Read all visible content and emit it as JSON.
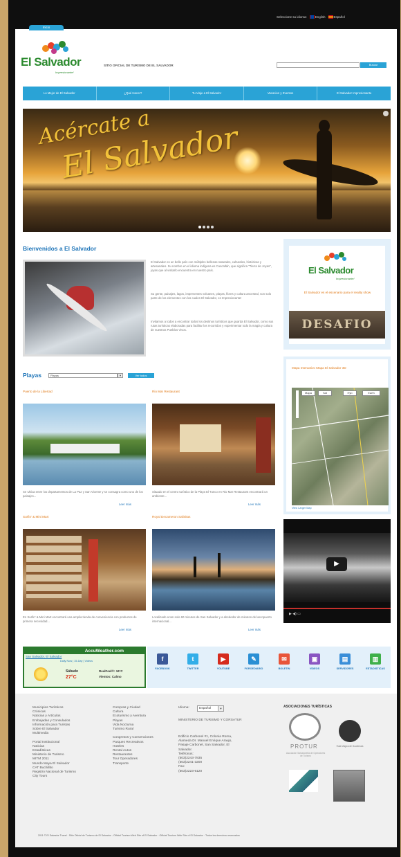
{
  "topbar": {
    "label": "Seleccione su idioma:",
    "english": "English",
    "espanol": "Español"
  },
  "tab": {
    "label": "Inicio"
  },
  "header": {
    "logo": "El Salvador",
    "logo_sub": "Impresionante!",
    "tagline": "SITIO OFICIAL DE TURISMO DE EL SALVADOR",
    "search_button": "Buscar"
  },
  "nav": [
    "Lo Mejor de El Salvador",
    "¿Qué Hacer?",
    "Tu Viaje a El Salvador",
    "Vacacion y Eventos",
    "El Salvador Impresionante"
  ],
  "hero": {
    "line1": "Acércate a",
    "line2": "El Salvador"
  },
  "welcome": {
    "title": "Bienvenidos a El Salvador",
    "p1": "El Salvador es un bello país con múltiples bellezas naturales, culturales, históricas y artesanales. Su nombre en el idioma indígena es Cuscatlán, que significa \"Tierra de Joyas\", joyas que al visitarlo encuentra en nuestro país.",
    "p2": "Su gente, paisajes, lagos, impresentes volcanes, playas, flores y cultura ancestral, son solo parte de los elementos con los cuales El Salvador, es Impresionante!",
    "p3": "Invitamos a todos a encontrar todos los destinos turísticos que guarda El Salvador, como sus rutas turísticas elaboradas para facilitar los recorridos y experimentar todo la magia y cultura de nuestros Pueblos Vivos."
  },
  "promo": {
    "logo": "El Salvador",
    "logo_sub": "Impresionante!",
    "text": "El Salvador es el escenario para el reality show",
    "banner": "DESAFIO"
  },
  "playas": {
    "title": "Playas",
    "select": "Playas",
    "button": "Ver todos"
  },
  "cards": [
    {
      "title": "Puerto de la Libertad",
      "desc": "Se Ubica entre los departamentos de La Paz y San Vicente y se consagra como uno de los paisajes...",
      "more": "Leer más"
    },
    {
      "title": "Rio Mar Restaurant",
      "desc": "Situado en el centro turístico de la Playa El Tunco en Rio Mar Restaurant encontrará un ambiente...",
      "more": "Leer más"
    },
    {
      "title": "Surfin' & Mini Mart",
      "desc": "En Surfin' & Mini Mart encontrará una amplia tienda de conveniencia con productos de primera necesidad...",
      "more": "Leer más"
    },
    {
      "title": "Royal Decameron Salinitas",
      "desc": "Localizado a tan solo 60 minutos de San Salvador y a alrededor de minutos del aeropuerto internacional...",
      "more": "Leer más"
    }
  ],
  "map": {
    "title": "Mapa Interactivo Mapa El Salvador 3D",
    "btn1": "Mapa",
    "btn2": "Sat",
    "btn3": "Hyb",
    "btn4": "Earth",
    "link": "View Larger Map"
  },
  "weather": {
    "brand": "AccuWeather.com",
    "location": "San Salvador, El Salvador",
    "links": "Daily Now | 15-Day | Videos",
    "day": "Sábado",
    "temp": "27°C",
    "realfeel": "RealFeel®: 34°C",
    "wind": "Vientos: Calmo"
  },
  "social": [
    {
      "label": "FACEBOOK",
      "color": "#3b5998",
      "glyph": "f"
    },
    {
      "label": "TWITTER",
      "color": "#33aee8",
      "glyph": "t"
    },
    {
      "label": "YOUTUBE",
      "color": "#d52b1e",
      "glyph": "▶"
    },
    {
      "label": "FOROEDIARIO",
      "color": "#2a8fd4",
      "glyph": "✎"
    },
    {
      "label": "BOLETIN",
      "color": "#e8553a",
      "glyph": "✉"
    },
    {
      "label": "VIDEOS",
      "color": "#8a55c2",
      "glyph": "▣"
    },
    {
      "label": "SERVIDORES",
      "color": "#3a8ed8",
      "glyph": "▤"
    },
    {
      "label": "ESTADISTICAS",
      "color": "#3fb04a",
      "glyph": "▥"
    }
  ],
  "footer": {
    "col1": [
      "Municipios Turísticos",
      "Crónicas",
      "Noticias y Artículos",
      "Embajadas y Consulados",
      "Información para Turistas",
      "Sobre El Salvador",
      "Multimedia",
      "",
      "Portal Institucional",
      "Noticias",
      "Estadísticas",
      "Ministerio de Turismo",
      "MITM 2011",
      "Mundo Maya El Salvador",
      "CAT Buchillito",
      "Registro Nacional de Turismo",
      "City Tours"
    ],
    "col2": [
      "Compras y Ciudad",
      "Cultura",
      "Ecoturismo y Aventura",
      "Playas",
      "Vida Nocturna",
      "Turismo Rural",
      "",
      "Congresos y Convenciones",
      "Parques Recreativos",
      "Hoteles",
      "Rental Autos",
      "Restaurantes",
      "Tour Operadores",
      "Transporte"
    ],
    "idioma_label": "Idioma:",
    "idioma_value": "Español",
    "ministry": "MINISTERIO DE TURISMO Y CORSATUR",
    "address": [
      "Edificio Carbonel #1, Colonia Roma,",
      "Alameda Dr. Manuel Enrique Araujo,",
      "Pasaje Carbonel, San Salvador, El",
      "Salvador.",
      "Teléfonos:",
      "(503)2243-7835",
      "(503)2241-3200",
      "Fax:",
      "(503)2223-6120"
    ],
    "assoc_title": "ASOCIACIONES TURÍSTICAS",
    "assoc1": "PROTUR",
    "assoc1_sub": "Asociación Salvadoreña de Operadores de Turismo",
    "assoc2_sub": "Ruta Mágica de Guatemala"
  },
  "copyright": "2011 © El Salvador Travel · Sitio Oficial de Turismo de El Salvador - Official Tourism Web Site of El Salvador · Official Tourism Web Site of El Salvador · Todos los derechos reservados"
}
